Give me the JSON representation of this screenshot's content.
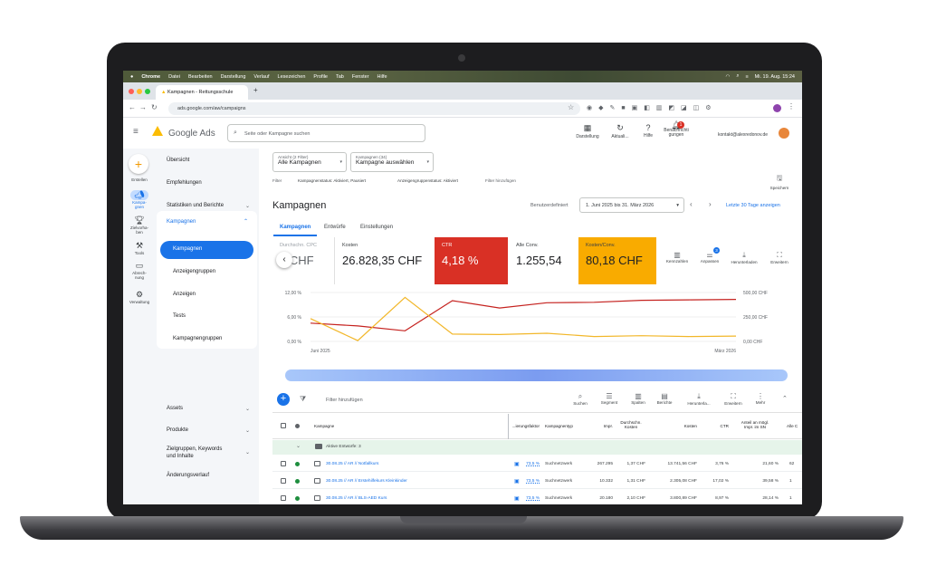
{
  "mac": {
    "apple": "",
    "app": "Chrome",
    "menus": [
      "Datei",
      "Bearbeiten",
      "Darstellung",
      "Verlauf",
      "Lesezeichen",
      "Profile",
      "Tab",
      "Fenster",
      "Hilfe"
    ],
    "clock": "Mi. 19. Aug.  15:24"
  },
  "browser": {
    "tab_title": "Kampagnen - Rettungsschule",
    "new_tab": "+",
    "url": "ads.google.com/aw/campaigns"
  },
  "header": {
    "logo": "Google Ads",
    "search_placeholder": "Seite oder Kampagne suchen",
    "actions": [
      "Darstellung",
      "Aktuali...",
      "Hilfe",
      "Benachrichti\ngungen"
    ],
    "notif_count": "1",
    "account": "kontakt@alexredonov.de"
  },
  "rail": [
    "Erstellen",
    "Kampa-\ngnen",
    "Zielvorha-\nben",
    "Tools",
    "Abrech-\nnung",
    "Verwaltung"
  ],
  "nav": {
    "items": [
      "Übersicht",
      "Empfehlungen",
      "Statistiken und Berichte",
      "Kampagnen",
      "Assets",
      "Produkte",
      "Zielgruppen, Keywords\nund Inhalte",
      "Änderungsverlauf"
    ],
    "sub": [
      "Kampagnen",
      "Anzeigengruppen",
      "Anzeigen",
      "Tests",
      "Kampagnengruppen"
    ]
  },
  "filters": {
    "view_label": "Ansicht (2 Filter)",
    "view_value": "Alle Kampagnen",
    "camp_label": "Kampagnen (34)",
    "camp_value": "Kampagne auswählen",
    "filter": "Filter",
    "f1": "Kampagnenstatus: Aktiviert, Pausiert",
    "f2": "Anzeigengruppenstatus: Aktiviert",
    "add": "Filter hinzufügen",
    "save": "Speichern"
  },
  "page": {
    "title": "Kampagnen",
    "date_label": "Benutzerdefiniert",
    "date_value": "1. Juni 2025 bis 31. März 2026",
    "last30": "Letzte 30 Tage anzeigen",
    "tabs": [
      "Kampagnen",
      "Entwürfe",
      "Einstellungen"
    ]
  },
  "cards": [
    {
      "label": "Durchschn. CPC",
      "value": "1,CHF"
    },
    {
      "label": "Kosten",
      "value": "26.828,35 CHF"
    },
    {
      "label": "CTR",
      "value": "4,18 %"
    },
    {
      "label": "Alle Conv.",
      "value": "1.255,54"
    },
    {
      "label": "Kosten/Conv.",
      "value": "80,18 CHF"
    }
  ],
  "card_tools": [
    "Kennzahlen",
    "Anpassen",
    "Herunterladen",
    "Erweitern"
  ],
  "anpassen_badge": "3",
  "chart_data": {
    "type": "line",
    "x": [
      "Juni 2025",
      "",
      "",
      "",
      "",
      "",
      "",
      "",
      "",
      "März 2026"
    ],
    "y_left": {
      "ticks": [
        "12,00 %",
        "6,00 %",
        "0,00 %"
      ],
      "range": [
        0,
        12
      ]
    },
    "y_right": {
      "ticks": [
        "500,00 CHF",
        "250,00 CHF",
        "0,00 CHF"
      ],
      "range": [
        0,
        500
      ]
    },
    "series": [
      {
        "values": [
          4.5,
          3.8,
          2.6,
          10.0,
          8.2,
          9.5,
          9.6,
          10.1,
          10.2,
          10.3
        ],
        "color": "#c5221f"
      },
      {
        "values": [
          5.6,
          0.2,
          10.8,
          1.8,
          1.7,
          2.0,
          1.2,
          1.4,
          1.2,
          1.3
        ],
        "color": "#f2b72a"
      }
    ],
    "x_labels": [
      "Juni 2025",
      "März 2026"
    ]
  },
  "table": {
    "toolbar": [
      "Suchen",
      "Segment",
      "Spalten",
      "Berichte",
      "Herunterla...",
      "Erweitern",
      "Mehr"
    ],
    "filter_add": "Filter hinzufügen",
    "headers": [
      "Kampagne",
      "...ierungsfaktor",
      "Kampagnentyp",
      "Impr.",
      "Durchschn.\nKosten",
      "Kosten",
      "CTR",
      "Anteil an mögl.\nImpr. im SN",
      "Alle C"
    ],
    "group": "Aktive Entwürfe: 3",
    "rows": [
      {
        "name": "30.08.25 // AR // Notfallkurs",
        "factor": "73,5 %",
        "type": "Suchnetzwerk",
        "impr": "267.295",
        "avg": "1,37 CHF",
        "cost": "13.741,56 CHF",
        "ctr": "3,76 %",
        "share": "21,60 %",
        "all": "62"
      },
      {
        "name": "30.08.25 // AR // Erstehilfekurs Kleinkinder",
        "factor": "73,5 %",
        "type": "Suchnetzwerk",
        "impr": "10.332",
        "avg": "1,31 CHF",
        "cost": "2.305,08 CHF",
        "ctr": "17,02 %",
        "share": "39,58 %",
        "all": "1"
      },
      {
        "name": "30.08.25 // AR // BLS-AED Kurs",
        "factor": "73,5 %",
        "type": "Suchnetzwerk",
        "impr": "20.180",
        "avg": "2,10 CHF",
        "cost": "3.800,89 CHF",
        "ctr": "8,97 %",
        "share": "28,14 %",
        "all": "1"
      }
    ]
  }
}
